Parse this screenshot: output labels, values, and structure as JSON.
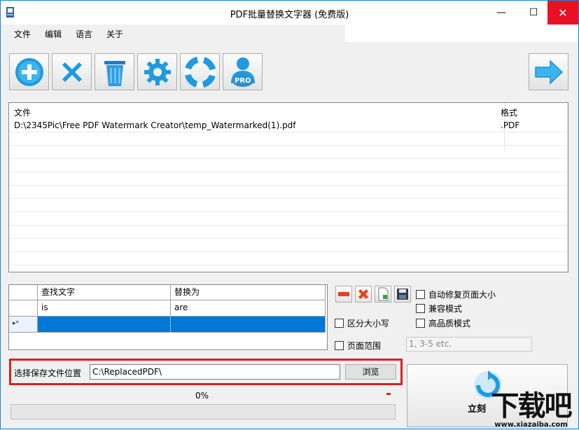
{
  "window": {
    "title": "PDF批量替换文字器 (免费版)",
    "min_glyph": "—",
    "max_glyph": "☐",
    "close_glyph": "✕"
  },
  "menu": [
    "文件",
    "编辑",
    "语言",
    "关于"
  ],
  "toolbar": {
    "buttons": [
      "add-file",
      "remove-file",
      "clear-list",
      "settings",
      "help",
      "pro"
    ],
    "pro_badge": "PRO",
    "next": "next-arrow"
  },
  "file_list": {
    "columns": [
      "文件",
      "格式"
    ],
    "rows": [
      {
        "file": "D:\\2345Pic\\Free PDF Watermark Creator\\temp_Watermarked(1).pdf",
        "format": ".PDF"
      }
    ]
  },
  "replace_grid": {
    "columns": [
      "查找文字",
      "替换为"
    ],
    "rows": [
      {
        "find": "is",
        "replace": "are"
      }
    ],
    "new_row_marker": "▸*"
  },
  "options": {
    "auto_fix_page_size": "自动修复页面大小",
    "compatible_mode": "兼容模式",
    "case_sensitive": "区分大小写",
    "high_quality_mode": "高品质模式",
    "page_range": "页面范围",
    "page_range_placeholder": "1, 3-5 etc."
  },
  "save": {
    "label": "选择保存文件位置",
    "path": "C:\\ReplacedPDF\\",
    "browse": "浏览"
  },
  "progress": {
    "percent_text": "0%",
    "value": 0
  },
  "start_button": {
    "label": "立刻"
  },
  "watermark": {
    "text": "下载吧",
    "sub": "www.xiazaiba.com"
  },
  "colors": {
    "accent": "#1883d7",
    "selection": "#0078d7",
    "highlight": "#e21d20"
  }
}
